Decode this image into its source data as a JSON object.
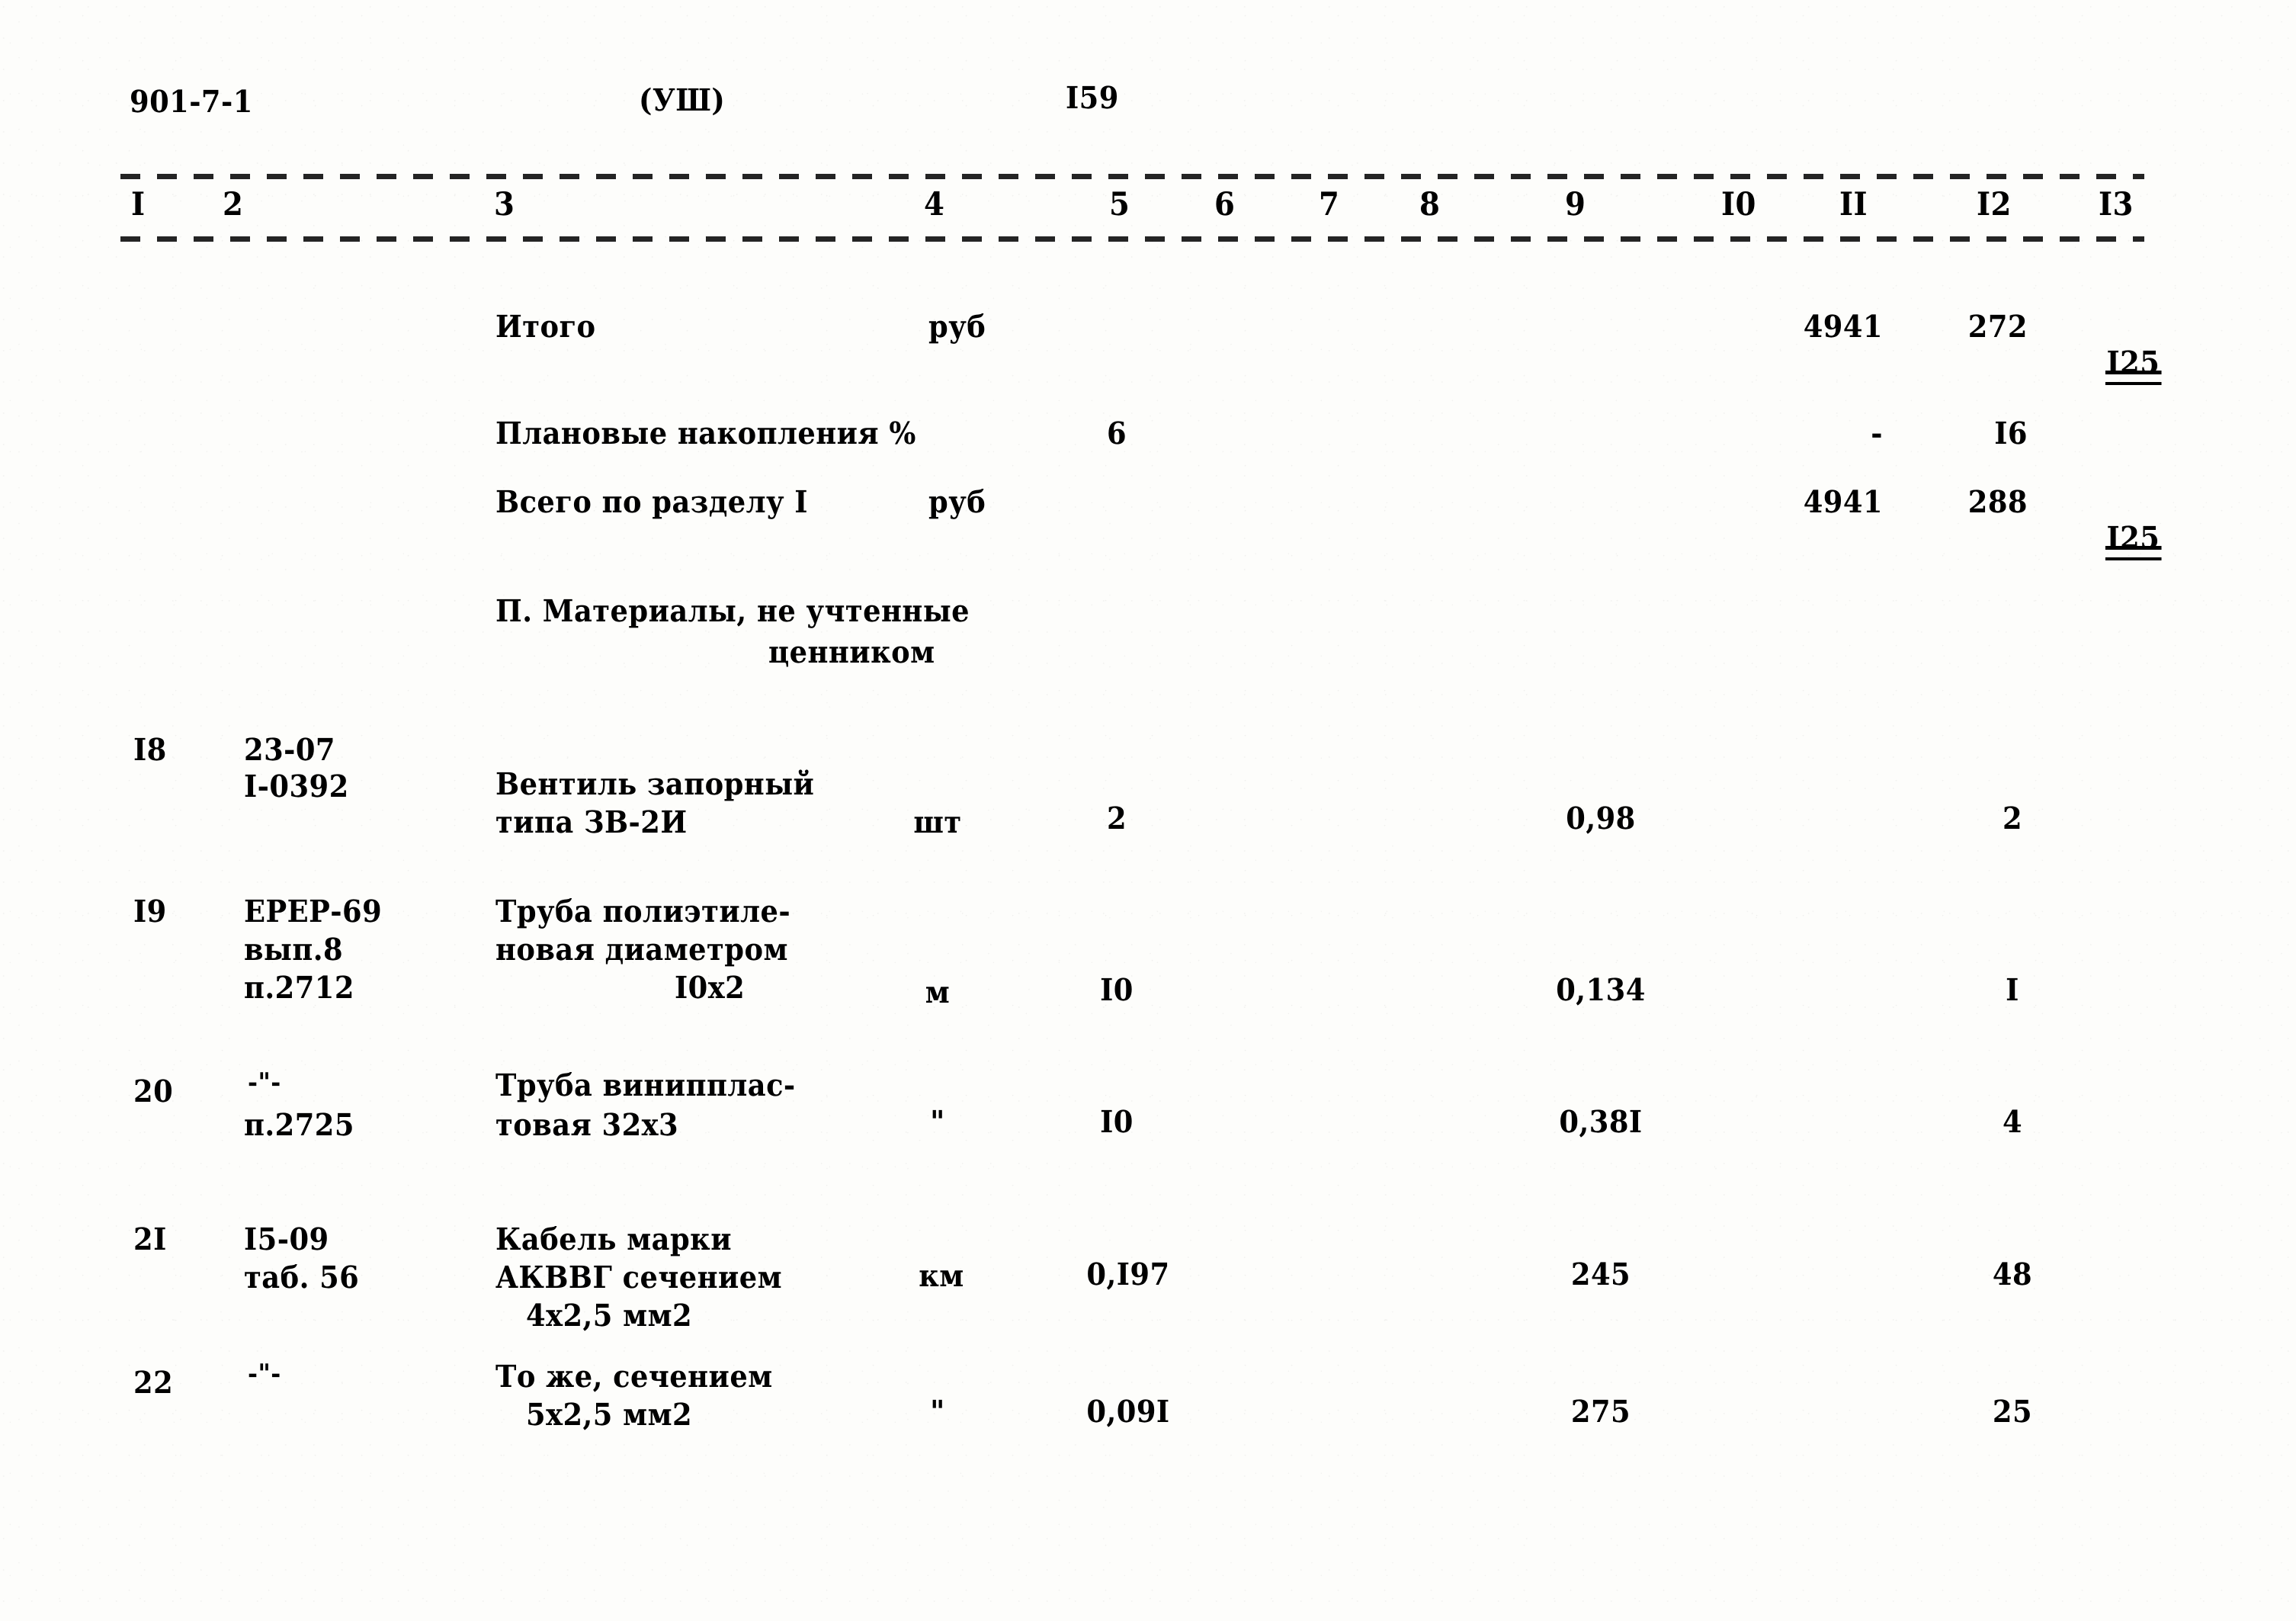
{
  "header": {
    "doc_code": "901-7-1",
    "series_marker": "(УШ)",
    "page_number": "I59"
  },
  "columns": {
    "labels": [
      "I",
      "2",
      "3",
      "4",
      "5",
      "6",
      "7",
      "8",
      "9",
      "I0",
      "II",
      "I2",
      "I3"
    ]
  },
  "summary_rows": [
    {
      "name": "Итого",
      "unit": "руб",
      "col5": "",
      "col11": "4941",
      "col12": "272",
      "col13": "I25",
      "col13_double_underline": true
    },
    {
      "name": "Плановые накопления %",
      "unit": "",
      "col5": "6",
      "col11": "-",
      "col12": "I6",
      "col13": "",
      "col13_double_underline": false
    },
    {
      "name": "Всего по разделу I",
      "unit": "руб",
      "col5": "",
      "col11": "4941",
      "col12": "288",
      "col13": "I25",
      "col13_double_underline": true
    }
  ],
  "section_heading": {
    "line1": "П. Материалы, не учтенные",
    "line2": "ценником"
  },
  "table_rows": [
    {
      "num": "I8",
      "code_lines": [
        "23-07",
        "I-0392"
      ],
      "desc_lines": [
        "Вентиль запорный",
        "типа ЗВ-2И"
      ],
      "unit": "шт",
      "qty": "2",
      "price": "0,98",
      "total": "2"
    },
    {
      "num": "I9",
      "code_lines": [
        "ЕРЕР-69",
        "вып.8",
        "п.2712"
      ],
      "desc_lines": [
        "Труба полиэтиле-",
        "новая диаметром",
        "I0x2"
      ],
      "unit": "м",
      "qty": "I0",
      "price": "0,134",
      "total": "I"
    },
    {
      "num": "20",
      "code_lines": [
        "-\"-",
        "п.2725"
      ],
      "desc_lines": [
        "Труба винипплас-",
        "товая 32x3"
      ],
      "unit": "\"",
      "qty": "I0",
      "price": "0,38I",
      "total": "4"
    },
    {
      "num": "2I",
      "code_lines": [
        "I5-09",
        "таб. 56"
      ],
      "desc_lines": [
        "Кабель марки",
        "АКВВГ сечением",
        "4х2,5 мм2"
      ],
      "unit": "км",
      "qty": "0,I97",
      "price": "245",
      "total": "48"
    },
    {
      "num": "22",
      "code_lines": [
        "-\"-"
      ],
      "desc_lines": [
        "То же, сечением",
        "5х2,5 мм2"
      ],
      "unit": "\"",
      "qty": "0,09I",
      "price": "275",
      "total": "25"
    }
  ]
}
